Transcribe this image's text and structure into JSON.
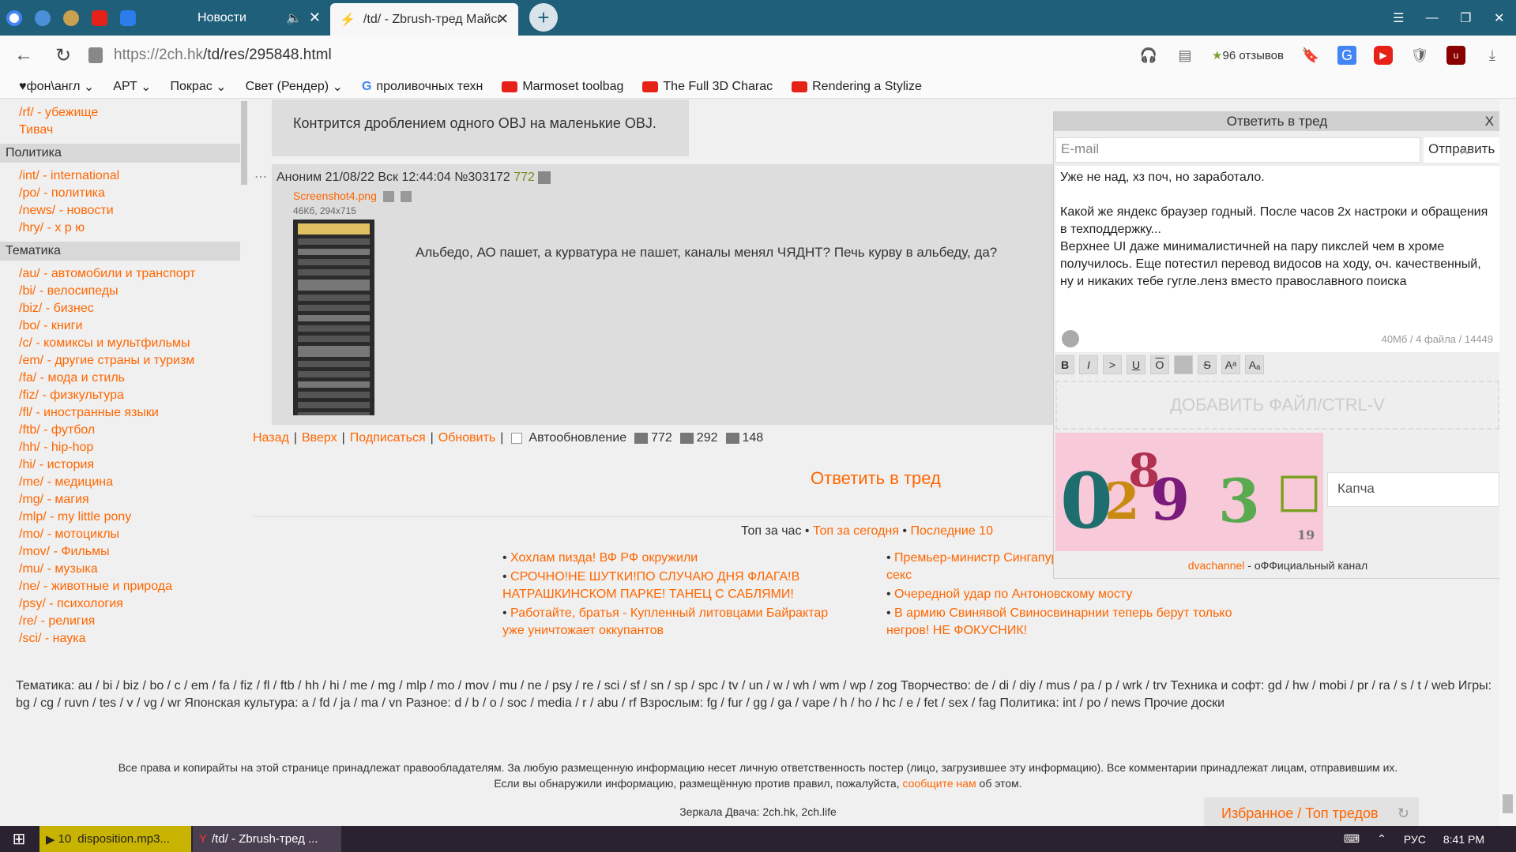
{
  "browser": {
    "tabs": [
      {
        "title": "Новости",
        "active": false
      },
      {
        "title": "/td/ - Zbrush-тред Майское",
        "active": true
      }
    ],
    "url_host": "https://2ch.hk",
    "url_path": "/td/res/295848.html",
    "reviews_label": "96 отзывов",
    "bookmarks": [
      "♥фон\\англ",
      "АРТ",
      "Покрас",
      "Свет (Рендер)",
      "проливочных техн",
      "Marmoset toolbag",
      "The Full 3D Charac",
      "Rendering a Stylize"
    ]
  },
  "sidebar": {
    "top_links": [
      "/rf/ - убежище",
      "Тивач"
    ],
    "sections": [
      {
        "title": "Политика",
        "links": [
          "/int/ - international",
          "/po/ - политика",
          "/news/ - новости",
          "/hry/ - х р ю"
        ]
      },
      {
        "title": "Тематика",
        "links": [
          "/au/ - автомобили и транспорт",
          "/bi/ - велосипеды",
          "/biz/ - бизнес",
          "/bo/ - книги",
          "/c/ - комиксы и мультфильмы",
          "/em/ - другие страны и туризм",
          "/fa/ - мода и стиль",
          "/fiz/ - физкультура",
          "/fl/ - иностранные языки",
          "/ftb/ - футбол",
          "/hh/ - hip-hop",
          "/hi/ - история",
          "/me/ - медицина",
          "/mg/ - магия",
          "/mlp/ - my little pony",
          "/mo/ - мотоциклы",
          "/mov/ - Фильмы",
          "/mu/ - музыка",
          "/ne/ - животные и природа",
          "/psy/ - психология",
          "/re/ - религия",
          "/sci/ - наука"
        ]
      }
    ]
  },
  "thread": {
    "prev_post_text": "Контрится дроблением одного OBJ на маленькие OBJ.",
    "post": {
      "author": "Аноним",
      "datetime": "21/08/22 Вск 12:44:04",
      "number": "№303172",
      "count": "772",
      "file_name": "Screenshot4.png",
      "file_meta": "46Кб, 294x715",
      "text": "Альбедо, АО пашет, а курватура не пашет, каналы менял ЧЯДНТ? Печь курву в альбеду, да?"
    },
    "nav": {
      "back": "Назад",
      "up": "Вверх",
      "subscribe": "Подписаться",
      "refresh": "Обновить",
      "autorefresh": "Автообновление",
      "posts": "772",
      "images": "292",
      "posters": "148"
    },
    "reply_link": "Ответить в тред",
    "tops": {
      "hour": "Топ за час",
      "today": "Топ за сегодня",
      "last": "Последние 10"
    },
    "news_left": [
      "Хохлам пизда! ВФ РФ окружили",
      "СРОЧНО!НЕ ШУТКИ!ПО СЛУЧАЮ ДНЯ ФЛАГА!В НАТРАШКИНСКОМ ПАРКЕ! ТАНЕЦ С САБЛЯМИ!",
      "Работайте, братья - Купленный литовцами Байрактар уже уничтожает оккупантов"
    ],
    "news_right": [
      "Премьер-министр Сингапура поставил крест на однополый секс",
      "Очередной удар по Антоновскому мосту",
      "В армию Свинявой Свиносвинарнии теперь берут только негров! НЕ ФОКУСНИК!"
    ]
  },
  "reply_form": {
    "title": "Ответить в тред",
    "close": "X",
    "email_placeholder": "E-mail",
    "send": "Отправить",
    "message": "Уже не над, хз поч, но заработало.\n\nКакой же яндекс браузер годный. После часов 2х настроки и обращения в техподдержку...\nВерхнее UI даже минималистичней на пару пикслей чем в хроме получилось. Еще потестил перевод видосов на ходу, оч. качественный, ну и никаких тебе гугле.ленз вместо православного поиска",
    "limits": "40Мб / 4 файла / 14449",
    "tools": [
      "B",
      "I",
      ">",
      "U",
      "O",
      "",
      "S",
      "Aᵃ",
      "Aₐ"
    ],
    "dropzone": "ДОБАВИТЬ ФАЙЛ/CTRL-V",
    "captcha_digits": [
      "0",
      "2",
      "8",
      "9",
      "3",
      "□",
      "19"
    ],
    "captcha_placeholder": "Капча",
    "channel_link": "dvachannel",
    "channel_text": "- оФФициальный канал"
  },
  "footer": {
    "boardlist": "Тематика: au / bi / biz / bo / c / em / fa / fiz / fl / ftb / hh / hi / me / mg / mlp / mo / mov / mu / ne / psy / re / sci / sf / sn / sp / spc / tv / un / w / wh / wm / wp / zog Творчество: de / di / diy / mus / pa / p / wrk / trv Техника и софт: gd / hw / mobi / pr / ra / s / t / web Игры: bg / cg / ruvn / tes / v / vg / wr Японская культура: a / fd / ja / ma / vn Разное: d / b / o / soc / media / r / abu / rf Взрослым: fg / fur / gg / ga / vape / h / ho / hc / e / fet / sex / fag Политика: int / po / news Прочие доски",
    "copyright": "Все права и копирайты на этой странице принадлежат правообладателям. За любую размещенную информацию несет личную ответственность постер (лицо, загрузившее эту информацию). Все комментарии принадлежат лицам, отправившим их.",
    "report_pre": "Если вы обнаружили информацию, размещённую против правил, пожалуйста,",
    "report_link": "сообщите нам",
    "report_post": "об этом.",
    "mirrors": "Зеркала Двача: 2ch.hk, 2ch.life",
    "favorites": "Избранное / Топ тредов"
  },
  "taskbar": {
    "item1": "disposition.mp3...",
    "item1_count": "10",
    "item2": "/td/ - Zbrush-тред ...",
    "lang": "РУС",
    "time": "8:41 PM"
  }
}
